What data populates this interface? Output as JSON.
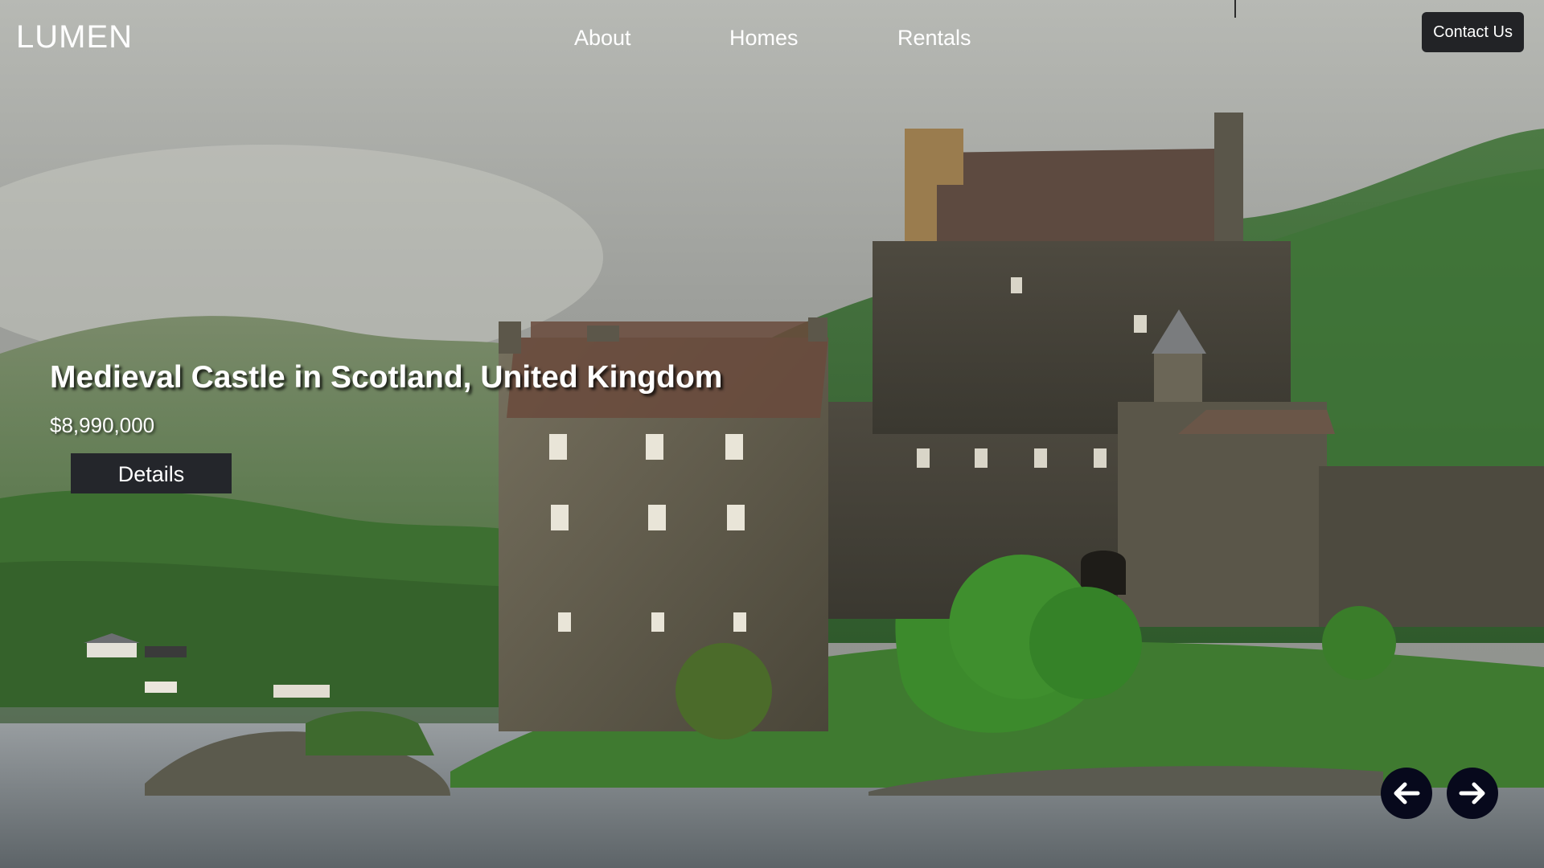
{
  "brand": {
    "logo_text": "LUMEN"
  },
  "nav": {
    "items": [
      {
        "label": "About"
      },
      {
        "label": "Homes"
      },
      {
        "label": "Rentals"
      }
    ],
    "contact_label": "Contact Us"
  },
  "hero": {
    "title": "Medieval Castle in Scotland, United Kingdom",
    "price": "$8,990,000",
    "details_label": "Details",
    "image_subject": "stone castle on a loch with green hills",
    "prev_icon": "arrow-left-icon",
    "next_icon": "arrow-right-icon"
  },
  "colors": {
    "button_dark": "#24262b",
    "arrow_bg": "#07091c",
    "text": "#ffffff"
  }
}
